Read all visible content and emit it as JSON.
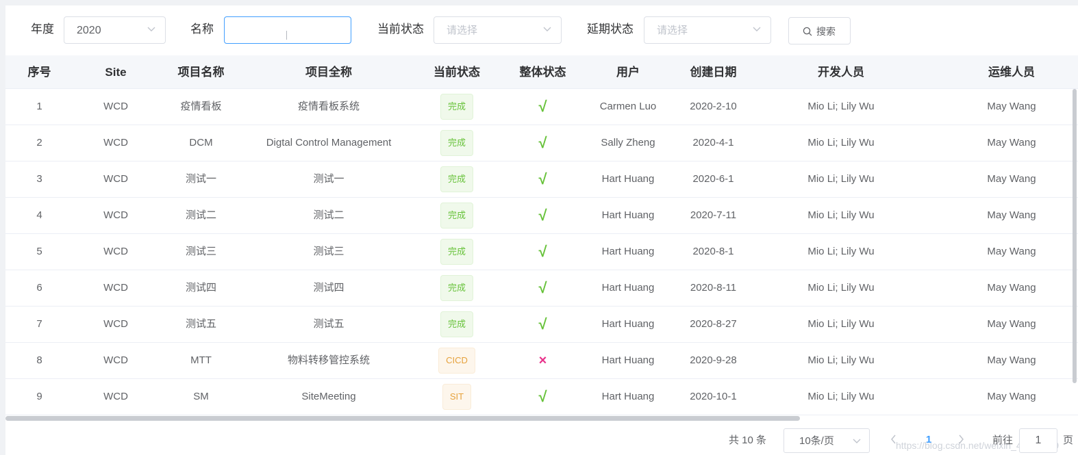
{
  "filters": {
    "year": {
      "label": "年度",
      "value": "2020"
    },
    "name": {
      "label": "名称",
      "value": "",
      "placeholder": ""
    },
    "current_status": {
      "label": "当前状态",
      "placeholder": "请选择"
    },
    "delay_status": {
      "label": "延期状态",
      "placeholder": "请选择"
    },
    "search_label": "搜索"
  },
  "table": {
    "columns": [
      "序号",
      "Site",
      "项目名称",
      "项目全称",
      "当前状态",
      "整体状态",
      "用户",
      "创建日期",
      "开发人员",
      "运维人员"
    ],
    "rows": [
      {
        "index": "1",
        "site": "WCD",
        "name": "疫情看板",
        "full_name": "疫情看板系统",
        "status": "完成",
        "status_type": "success",
        "overall": "√",
        "overall_ok": true,
        "user": "Carmen Luo",
        "created": "2020-2-10",
        "developers": "Mio Li; Lily Wu",
        "ops": "May Wang"
      },
      {
        "index": "2",
        "site": "WCD",
        "name": "DCM",
        "full_name": "Digtal Control Management",
        "status": "完成",
        "status_type": "success",
        "overall": "√",
        "overall_ok": true,
        "user": "Sally Zheng",
        "created": "2020-4-1",
        "developers": "Mio Li; Lily Wu",
        "ops": "May Wang"
      },
      {
        "index": "3",
        "site": "WCD",
        "name": "测试一",
        "full_name": "测试一",
        "status": "完成",
        "status_type": "success",
        "overall": "√",
        "overall_ok": true,
        "user": "Hart Huang",
        "created": "2020-6-1",
        "developers": "Mio Li; Lily Wu",
        "ops": "May Wang"
      },
      {
        "index": "4",
        "site": "WCD",
        "name": "测试二",
        "full_name": "测试二",
        "status": "完成",
        "status_type": "success",
        "overall": "√",
        "overall_ok": true,
        "user": "Hart Huang",
        "created": "2020-7-11",
        "developers": "Mio Li; Lily Wu",
        "ops": "May Wang"
      },
      {
        "index": "5",
        "site": "WCD",
        "name": "测试三",
        "full_name": "测试三",
        "status": "完成",
        "status_type": "success",
        "overall": "√",
        "overall_ok": true,
        "user": "Hart Huang",
        "created": "2020-8-1",
        "developers": "Mio Li; Lily Wu",
        "ops": "May Wang"
      },
      {
        "index": "6",
        "site": "WCD",
        "name": "测试四",
        "full_name": "测试四",
        "status": "完成",
        "status_type": "success",
        "overall": "√",
        "overall_ok": true,
        "user": "Hart Huang",
        "created": "2020-8-11",
        "developers": "Mio Li; Lily Wu",
        "ops": "May Wang"
      },
      {
        "index": "7",
        "site": "WCD",
        "name": "测试五",
        "full_name": "测试五",
        "status": "完成",
        "status_type": "success",
        "overall": "√",
        "overall_ok": true,
        "user": "Hart Huang",
        "created": "2020-8-27",
        "developers": "Mio Li; Lily Wu",
        "ops": "May Wang"
      },
      {
        "index": "8",
        "site": "WCD",
        "name": "MTT",
        "full_name": "物料转移管控系统",
        "status": "CICD",
        "status_type": "warning",
        "overall": "×",
        "overall_ok": false,
        "user": "Hart Huang",
        "created": "2020-9-28",
        "developers": "Mio Li; Lily Wu",
        "ops": "May Wang"
      },
      {
        "index": "9",
        "site": "WCD",
        "name": "SM",
        "full_name": "SiteMeeting",
        "status": "SIT",
        "status_type": "warning",
        "overall": "√",
        "overall_ok": true,
        "user": "Hart Huang",
        "created": "2020-10-1",
        "developers": "Mio Li; Lily Wu",
        "ops": "May Wang"
      }
    ]
  },
  "pagination": {
    "total": "共 10 条",
    "page_size": "10条/页",
    "current_page": "1",
    "goto_label": "前往",
    "goto_value": "1",
    "page_unit": "页",
    "watermark": "https://blog.csdn.net/weixin_44104809"
  },
  "colors": {
    "primary": "#409eff",
    "success": "#67c23a",
    "warning": "#e6a23c",
    "danger_mark": "#e8318a",
    "header_bg": "#f5f7fa"
  },
  "icons": {
    "search": "search-icon",
    "chevron": "chevron-down-icon",
    "prev": "chevron-left-icon",
    "next": "chevron-right-icon"
  }
}
